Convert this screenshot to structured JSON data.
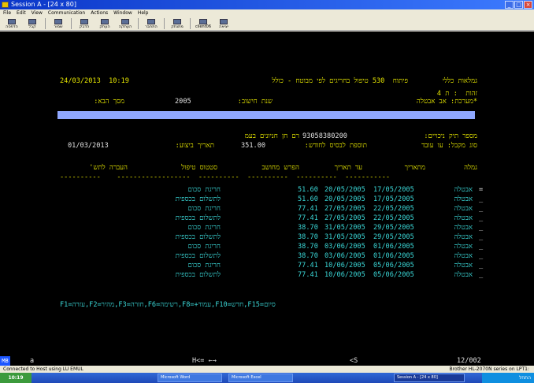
{
  "window": {
    "title": "Session A - [24 x 80]"
  },
  "menu": [
    "File",
    "Edit",
    "View",
    "Communication",
    "Actions",
    "Window",
    "Help"
  ],
  "toolbar": [
    "הדפסה",
    "קבל",
    "שמור",
    "הדבק",
    "העתק",
    "העתקה",
    "התחבר",
    "מתנתק",
    "client06",
    "יציאה"
  ],
  "screen": {
    "header_left": "24/03/2013  10:19",
    "header_title": "פיתוח  530 טיפול בחריגים לפי מבוטח - כולל",
    "header_right": "גמלאות כללי",
    "id_label": "זהות  : ת 4",
    "system_label": "*מערכת: אב אבטלה",
    "next_screen_label": "מסך הבא:",
    "calc_year_label": "שנת חישוב:",
    "calc_year_value": "2005",
    "deduction_file_label": "מספר תיק ניכויים:",
    "deduction_file_value": "93058380200",
    "deduction_file_name": "רם חן חניונים בעמ",
    "recipient_label": "סוג מקבל: עו עובד",
    "monthly_addition_label": "תוספת לבסיס לחודש:",
    "monthly_addition_value": "351.00",
    "execution_date_label": "תאריך ביצוע:",
    "execution_date_value": "01/03/2013",
    "columns": [
      "גמלה",
      "מתאריך",
      "עד תאריך",
      "הפרש מחושב",
      "סטטוס טיפול",
      "העברה לתש'"
    ],
    "rows": [
      {
        "marker": "=",
        "benefit": "אבטלה",
        "from": "17/05/2005",
        "to": "20/05/2005",
        "diff": "51.60",
        "status": "חריגת סכום"
      },
      {
        "marker": "_",
        "benefit": "אבטלה",
        "from": "17/05/2005",
        "to": "20/05/2005",
        "diff": "51.60",
        "status": "לתשלום בכספית"
      },
      {
        "marker": "_",
        "benefit": "אבטלה",
        "from": "22/05/2005",
        "to": "27/05/2005",
        "diff": "77.41",
        "status": "חריגת סכום"
      },
      {
        "marker": "_",
        "benefit": "אבטלה",
        "from": "22/05/2005",
        "to": "27/05/2005",
        "diff": "77.41",
        "status": "לתשלום בכספית"
      },
      {
        "marker": "_",
        "benefit": "אבטלה",
        "from": "29/05/2005",
        "to": "31/05/2005",
        "diff": "38.70",
        "status": "חריגת סכום"
      },
      {
        "marker": "_",
        "benefit": "אבטלה",
        "from": "29/05/2005",
        "to": "31/05/2005",
        "diff": "38.70",
        "status": "לתשלום בכספית"
      },
      {
        "marker": "_",
        "benefit": "אבטלה",
        "from": "01/06/2005",
        "to": "03/06/2005",
        "diff": "38.70",
        "status": "חריגת סכום"
      },
      {
        "marker": "_",
        "benefit": "אבטלה",
        "from": "01/06/2005",
        "to": "03/06/2005",
        "diff": "38.70",
        "status": "לתשלום בכספית"
      },
      {
        "marker": "_",
        "benefit": "אבטלה",
        "from": "05/06/2005",
        "to": "10/06/2005",
        "diff": "77.41",
        "status": "חריגת סכום"
      },
      {
        "marker": "_",
        "benefit": "אבטלה",
        "from": "05/06/2005",
        "to": "10/06/2005",
        "diff": "77.41",
        "status": "לתשלום בכספית"
      }
    ],
    "function_keys": "F1=עזרה,F2=מהיר,F3=חזרה,F6=רשימה,F8=+עמוד,F10=חדש,F15=סיום"
  },
  "status_line": {
    "mb": "MB",
    "session": "a",
    "cursor_mode": "H<= ←→",
    "screen": "<S",
    "position": "12/002"
  },
  "info_bar": {
    "left": "Connected to Host using LU EMUL",
    "right": "Brother HL-2070N series on LPT1:"
  },
  "taskbar": {
    "start": "התחל",
    "items": [
      "Microsoft Word",
      "Microsoft Excel",
      "Session A - [24 x 80]"
    ],
    "clock": "10:19"
  }
}
